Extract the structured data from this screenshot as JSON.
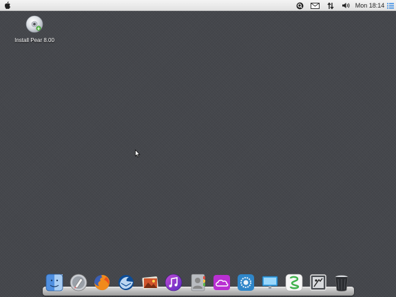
{
  "menubar": {
    "apple_menu": "apple-icon",
    "status_icons": [
      "search-icon",
      "mail-icon",
      "network-icon",
      "volume-icon"
    ],
    "clock": "Mon 18:14",
    "notifications": "list-icon"
  },
  "desktop": {
    "icons": [
      {
        "label": "Install Pear 8.00",
        "icon": "disc-icon"
      }
    ]
  },
  "dock": {
    "items": [
      "finder-icon",
      "launchpad-icon",
      "firefox-icon",
      "thunderbird-icon",
      "photos-icon",
      "itunes-icon",
      "contacts-icon",
      "cloud-icon",
      "app-store-icon",
      "display-icon",
      "messages-icon",
      "scanner-icon",
      "trash-icon"
    ]
  }
}
